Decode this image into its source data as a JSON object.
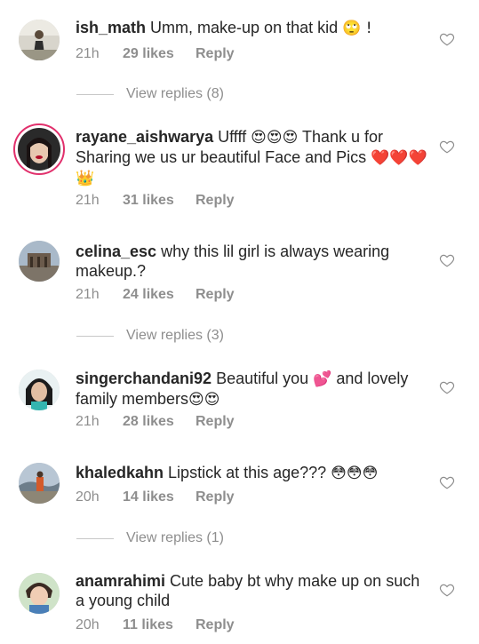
{
  "comments": [
    {
      "username": "ish_math",
      "text": " Umm, make-up on that kid ",
      "emoji_end": "🙄 !",
      "time": "21h",
      "likes": "29 likes",
      "reply": "Reply"
    },
    {
      "username": "rayane_aishwarya",
      "text": " Uffff ",
      "emoji_a": "😍😍😍",
      "text2": " Thank u for Sharing we us ur beautiful Face and Pics ",
      "emoji_end": "❤️❤️❤️👑",
      "time": "21h",
      "likes": "31 likes",
      "reply": "Reply"
    },
    {
      "username": "celina_esc",
      "text": " why this lil girl is always wearing makeup.?",
      "time": "21h",
      "likes": "24 likes",
      "reply": "Reply"
    },
    {
      "username": "singerchandani92",
      "text": " Beautiful you ",
      "emoji_a": "💕",
      "text2": " and lovely family members",
      "emoji_end": "😍😍",
      "time": "21h",
      "likes": "28 likes",
      "reply": "Reply"
    },
    {
      "username": "khaledkahn",
      "text": " Lipstick at this age??? ",
      "emoji_end": "😳😳😳",
      "time": "20h",
      "likes": "14 likes",
      "reply": "Reply"
    },
    {
      "username": "anamrahimi",
      "text": " Cute baby bt why make up on such a young child",
      "time": "20h",
      "likes": "11 likes",
      "reply": "Reply"
    }
  ],
  "view_replies": [
    "View replies (8)",
    "View replies (3)",
    "View replies (1)"
  ]
}
